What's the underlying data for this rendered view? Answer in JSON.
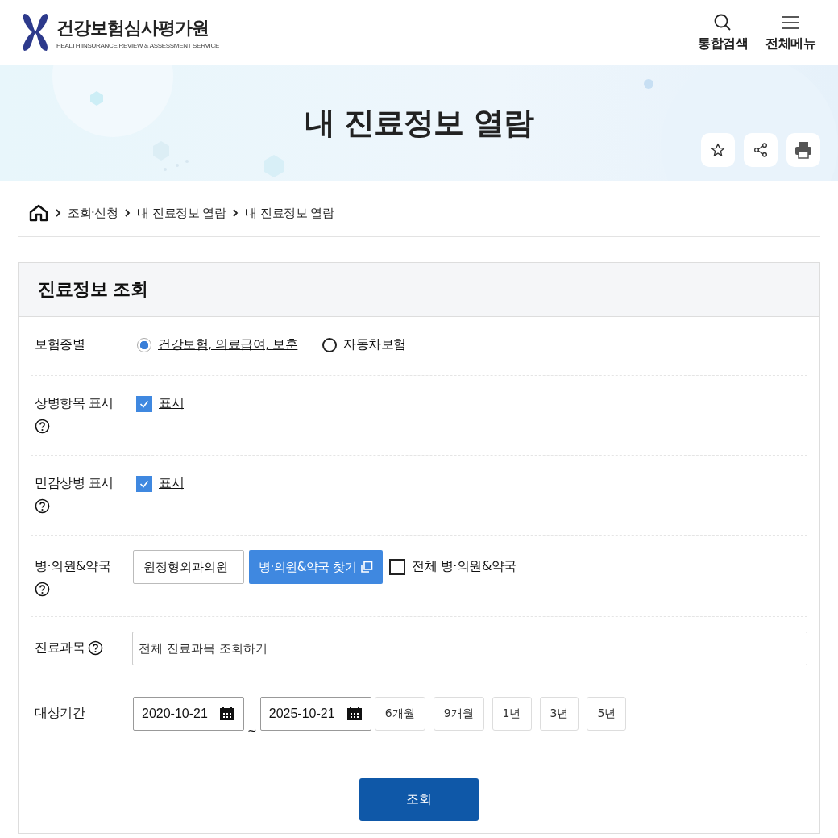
{
  "header": {
    "logo": {
      "name": "건강보험심사평가원",
      "subtitle": "HEALTH INSURANCE REVIEW & ASSESSMENT SERVICE"
    },
    "actions": [
      {
        "kind": "search",
        "label": "통합검색"
      },
      {
        "kind": "menu",
        "label": "전체메뉴"
      }
    ]
  },
  "banner": {
    "title": "내 진료정보 열람",
    "tools": [
      {
        "kind": "star"
      },
      {
        "kind": "share"
      },
      {
        "kind": "print"
      }
    ]
  },
  "breadcrumb": [
    "조회·신청",
    "내 진료정보 열람",
    "내 진료정보 열람"
  ],
  "panel": {
    "title": "진료정보 조회",
    "rows": [
      {
        "kind": "radio",
        "label": "보험종별",
        "help": false,
        "options": [
          {
            "label": "건강보험, 의료급여, 보훈",
            "selected": true
          },
          {
            "label": "자동차보험",
            "selected": false
          }
        ]
      },
      {
        "kind": "checkbox",
        "label": "상병항목 표시",
        "help": true,
        "checked": true,
        "option": "표시"
      },
      {
        "kind": "checkbox",
        "label": "민감상병 표시",
        "help": true,
        "checked": true,
        "option": "표시"
      },
      {
        "kind": "hospital",
        "label": "병·의원&약국",
        "help": true,
        "value": "원정형외과의원",
        "button": "병·의원&약국 찾기",
        "all": {
          "label": "전체 병·의원&약국",
          "checked": false
        }
      },
      {
        "kind": "subject",
        "label": "진료과목",
        "help": true,
        "value": "전체 진료과목 조회하기"
      },
      {
        "kind": "period",
        "label": "대상기간",
        "help": false,
        "from": "2020-10-21",
        "separator": "~",
        "to": "2025-10-21",
        "presets": [
          {
            "label": "6개월",
            "selected": false
          },
          {
            "label": "9개월",
            "selected": false
          },
          {
            "label": "1년",
            "selected": false
          },
          {
            "label": "3년",
            "selected": false
          },
          {
            "label": "5년",
            "selected": false
          }
        ]
      }
    ],
    "submit": "조회"
  }
}
